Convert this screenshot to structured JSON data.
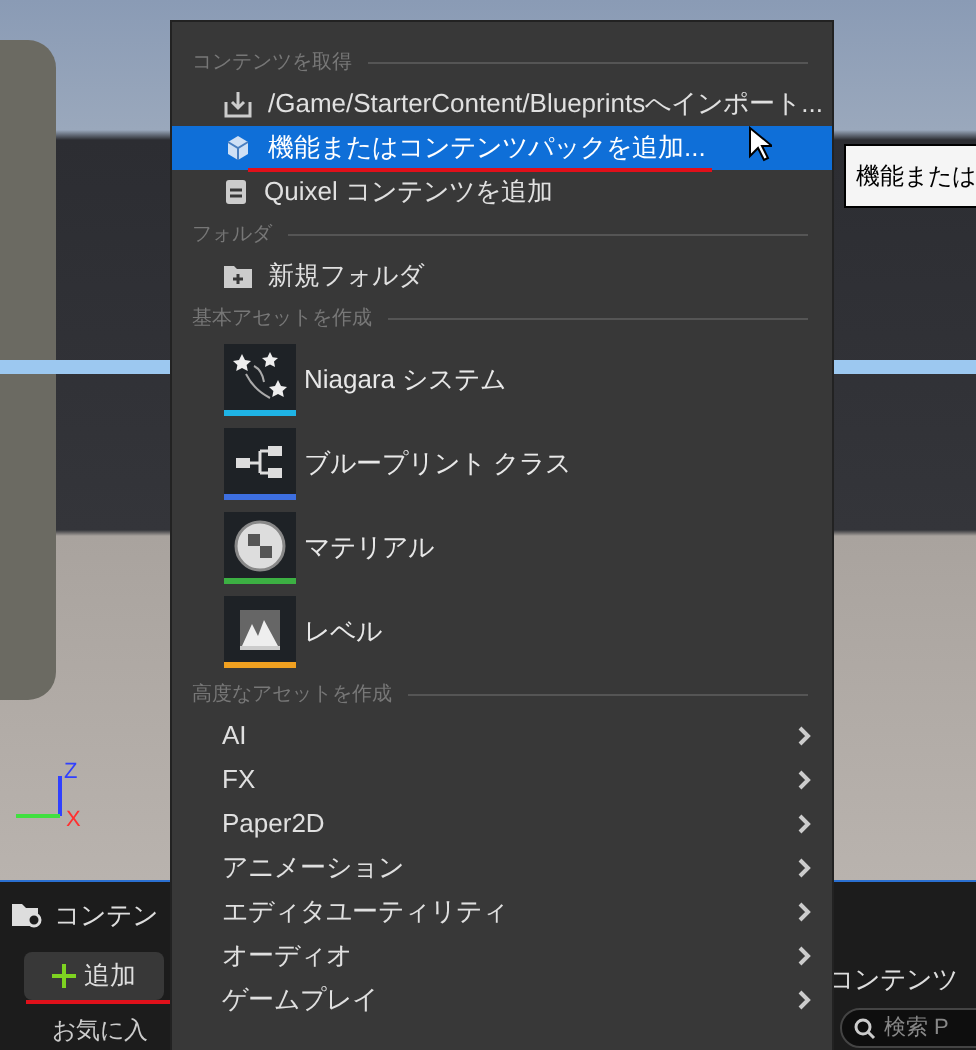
{
  "viewport": {
    "axis_labels": [
      "Z",
      "X"
    ]
  },
  "menu": {
    "sections": [
      {
        "heading": "コンテンツを取得",
        "kind": "actions",
        "items": [
          {
            "label": "/Game/StarterContent/Blueprintsへインポート...",
            "kind": "import",
            "selected": false,
            "underlined": false
          },
          {
            "label": "機能またはコンテンツパックを追加...",
            "kind": "pack",
            "selected": true,
            "underlined": true
          },
          {
            "label": "Quixel コンテンツを追加",
            "kind": "quixel",
            "selected": false,
            "underlined": false
          }
        ]
      },
      {
        "heading": "フォルダ",
        "kind": "actions",
        "items": [
          {
            "label": "新規フォルダ",
            "kind": "folder",
            "selected": false,
            "underlined": false
          }
        ]
      },
      {
        "heading": "基本アセットを作成",
        "kind": "assets",
        "items": [
          {
            "label": "Niagara システム",
            "kind": "niagara",
            "color": "#1fb4e6"
          },
          {
            "label": "ブループリント クラス",
            "kind": "blueprint",
            "color": "#3d6fe0"
          },
          {
            "label": "マテリアル",
            "kind": "material",
            "color": "#3cb043"
          },
          {
            "label": "レベル",
            "kind": "level",
            "color": "#f0a020"
          }
        ]
      },
      {
        "heading": "高度なアセットを作成",
        "kind": "submenus",
        "items": [
          {
            "label": "AI"
          },
          {
            "label": "FX"
          },
          {
            "label": "Paper2D"
          },
          {
            "label": "アニメーション"
          },
          {
            "label": "エディタユーティリティ"
          },
          {
            "label": "オーディオ"
          },
          {
            "label": "ゲームプレイ"
          }
        ]
      }
    ]
  },
  "tooltip": {
    "text": "機能または"
  },
  "content_browser": {
    "tab": "コンテン",
    "add_button": {
      "label": "追加",
      "underlined": true
    },
    "favorites": "お気に入",
    "right_tab": "コンテンツ",
    "search_placeholder": "検索 P"
  }
}
